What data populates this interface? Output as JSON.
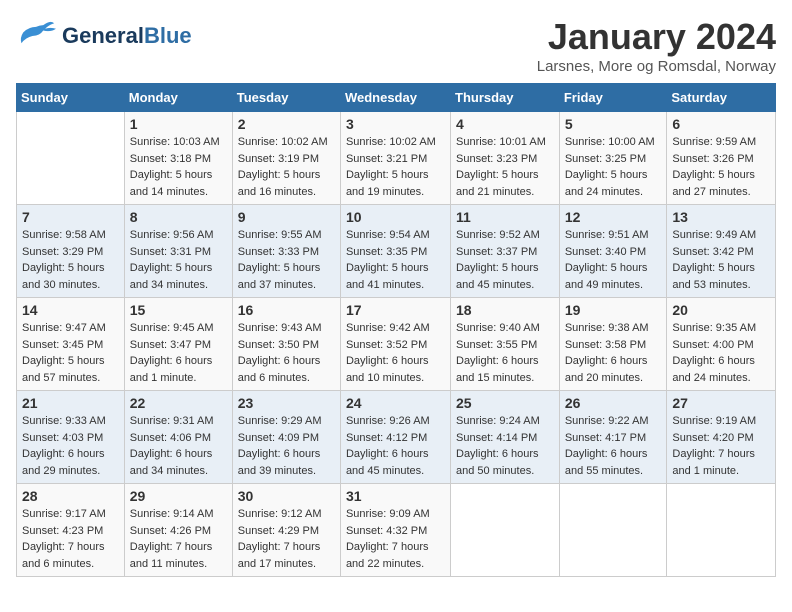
{
  "header": {
    "logo": {
      "line1": "General",
      "line2": "Blue"
    },
    "title": "January 2024",
    "subtitle": "Larsnes, More og Romsdal, Norway"
  },
  "weekdays": [
    "Sunday",
    "Monday",
    "Tuesday",
    "Wednesday",
    "Thursday",
    "Friday",
    "Saturday"
  ],
  "weeks": [
    [
      {
        "day": "",
        "sunrise": "",
        "sunset": "",
        "daylight": ""
      },
      {
        "day": "1",
        "sunrise": "Sunrise: 10:03 AM",
        "sunset": "Sunset: 3:18 PM",
        "daylight": "Daylight: 5 hours and 14 minutes."
      },
      {
        "day": "2",
        "sunrise": "Sunrise: 10:02 AM",
        "sunset": "Sunset: 3:19 PM",
        "daylight": "Daylight: 5 hours and 16 minutes."
      },
      {
        "day": "3",
        "sunrise": "Sunrise: 10:02 AM",
        "sunset": "Sunset: 3:21 PM",
        "daylight": "Daylight: 5 hours and 19 minutes."
      },
      {
        "day": "4",
        "sunrise": "Sunrise: 10:01 AM",
        "sunset": "Sunset: 3:23 PM",
        "daylight": "Daylight: 5 hours and 21 minutes."
      },
      {
        "day": "5",
        "sunrise": "Sunrise: 10:00 AM",
        "sunset": "Sunset: 3:25 PM",
        "daylight": "Daylight: 5 hours and 24 minutes."
      },
      {
        "day": "6",
        "sunrise": "Sunrise: 9:59 AM",
        "sunset": "Sunset: 3:26 PM",
        "daylight": "Daylight: 5 hours and 27 minutes."
      }
    ],
    [
      {
        "day": "7",
        "sunrise": "Sunrise: 9:58 AM",
        "sunset": "Sunset: 3:29 PM",
        "daylight": "Daylight: 5 hours and 30 minutes."
      },
      {
        "day": "8",
        "sunrise": "Sunrise: 9:56 AM",
        "sunset": "Sunset: 3:31 PM",
        "daylight": "Daylight: 5 hours and 34 minutes."
      },
      {
        "day": "9",
        "sunrise": "Sunrise: 9:55 AM",
        "sunset": "Sunset: 3:33 PM",
        "daylight": "Daylight: 5 hours and 37 minutes."
      },
      {
        "day": "10",
        "sunrise": "Sunrise: 9:54 AM",
        "sunset": "Sunset: 3:35 PM",
        "daylight": "Daylight: 5 hours and 41 minutes."
      },
      {
        "day": "11",
        "sunrise": "Sunrise: 9:52 AM",
        "sunset": "Sunset: 3:37 PM",
        "daylight": "Daylight: 5 hours and 45 minutes."
      },
      {
        "day": "12",
        "sunrise": "Sunrise: 9:51 AM",
        "sunset": "Sunset: 3:40 PM",
        "daylight": "Daylight: 5 hours and 49 minutes."
      },
      {
        "day": "13",
        "sunrise": "Sunrise: 9:49 AM",
        "sunset": "Sunset: 3:42 PM",
        "daylight": "Daylight: 5 hours and 53 minutes."
      }
    ],
    [
      {
        "day": "14",
        "sunrise": "Sunrise: 9:47 AM",
        "sunset": "Sunset: 3:45 PM",
        "daylight": "Daylight: 5 hours and 57 minutes."
      },
      {
        "day": "15",
        "sunrise": "Sunrise: 9:45 AM",
        "sunset": "Sunset: 3:47 PM",
        "daylight": "Daylight: 6 hours and 1 minute."
      },
      {
        "day": "16",
        "sunrise": "Sunrise: 9:43 AM",
        "sunset": "Sunset: 3:50 PM",
        "daylight": "Daylight: 6 hours and 6 minutes."
      },
      {
        "day": "17",
        "sunrise": "Sunrise: 9:42 AM",
        "sunset": "Sunset: 3:52 PM",
        "daylight": "Daylight: 6 hours and 10 minutes."
      },
      {
        "day": "18",
        "sunrise": "Sunrise: 9:40 AM",
        "sunset": "Sunset: 3:55 PM",
        "daylight": "Daylight: 6 hours and 15 minutes."
      },
      {
        "day": "19",
        "sunrise": "Sunrise: 9:38 AM",
        "sunset": "Sunset: 3:58 PM",
        "daylight": "Daylight: 6 hours and 20 minutes."
      },
      {
        "day": "20",
        "sunrise": "Sunrise: 9:35 AM",
        "sunset": "Sunset: 4:00 PM",
        "daylight": "Daylight: 6 hours and 24 minutes."
      }
    ],
    [
      {
        "day": "21",
        "sunrise": "Sunrise: 9:33 AM",
        "sunset": "Sunset: 4:03 PM",
        "daylight": "Daylight: 6 hours and 29 minutes."
      },
      {
        "day": "22",
        "sunrise": "Sunrise: 9:31 AM",
        "sunset": "Sunset: 4:06 PM",
        "daylight": "Daylight: 6 hours and 34 minutes."
      },
      {
        "day": "23",
        "sunrise": "Sunrise: 9:29 AM",
        "sunset": "Sunset: 4:09 PM",
        "daylight": "Daylight: 6 hours and 39 minutes."
      },
      {
        "day": "24",
        "sunrise": "Sunrise: 9:26 AM",
        "sunset": "Sunset: 4:12 PM",
        "daylight": "Daylight: 6 hours and 45 minutes."
      },
      {
        "day": "25",
        "sunrise": "Sunrise: 9:24 AM",
        "sunset": "Sunset: 4:14 PM",
        "daylight": "Daylight: 6 hours and 50 minutes."
      },
      {
        "day": "26",
        "sunrise": "Sunrise: 9:22 AM",
        "sunset": "Sunset: 4:17 PM",
        "daylight": "Daylight: 6 hours and 55 minutes."
      },
      {
        "day": "27",
        "sunrise": "Sunrise: 9:19 AM",
        "sunset": "Sunset: 4:20 PM",
        "daylight": "Daylight: 7 hours and 1 minute."
      }
    ],
    [
      {
        "day": "28",
        "sunrise": "Sunrise: 9:17 AM",
        "sunset": "Sunset: 4:23 PM",
        "daylight": "Daylight: 7 hours and 6 minutes."
      },
      {
        "day": "29",
        "sunrise": "Sunrise: 9:14 AM",
        "sunset": "Sunset: 4:26 PM",
        "daylight": "Daylight: 7 hours and 11 minutes."
      },
      {
        "day": "30",
        "sunrise": "Sunrise: 9:12 AM",
        "sunset": "Sunset: 4:29 PM",
        "daylight": "Daylight: 7 hours and 17 minutes."
      },
      {
        "day": "31",
        "sunrise": "Sunrise: 9:09 AM",
        "sunset": "Sunset: 4:32 PM",
        "daylight": "Daylight: 7 hours and 22 minutes."
      },
      {
        "day": "",
        "sunrise": "",
        "sunset": "",
        "daylight": ""
      },
      {
        "day": "",
        "sunrise": "",
        "sunset": "",
        "daylight": ""
      },
      {
        "day": "",
        "sunrise": "",
        "sunset": "",
        "daylight": ""
      }
    ]
  ]
}
